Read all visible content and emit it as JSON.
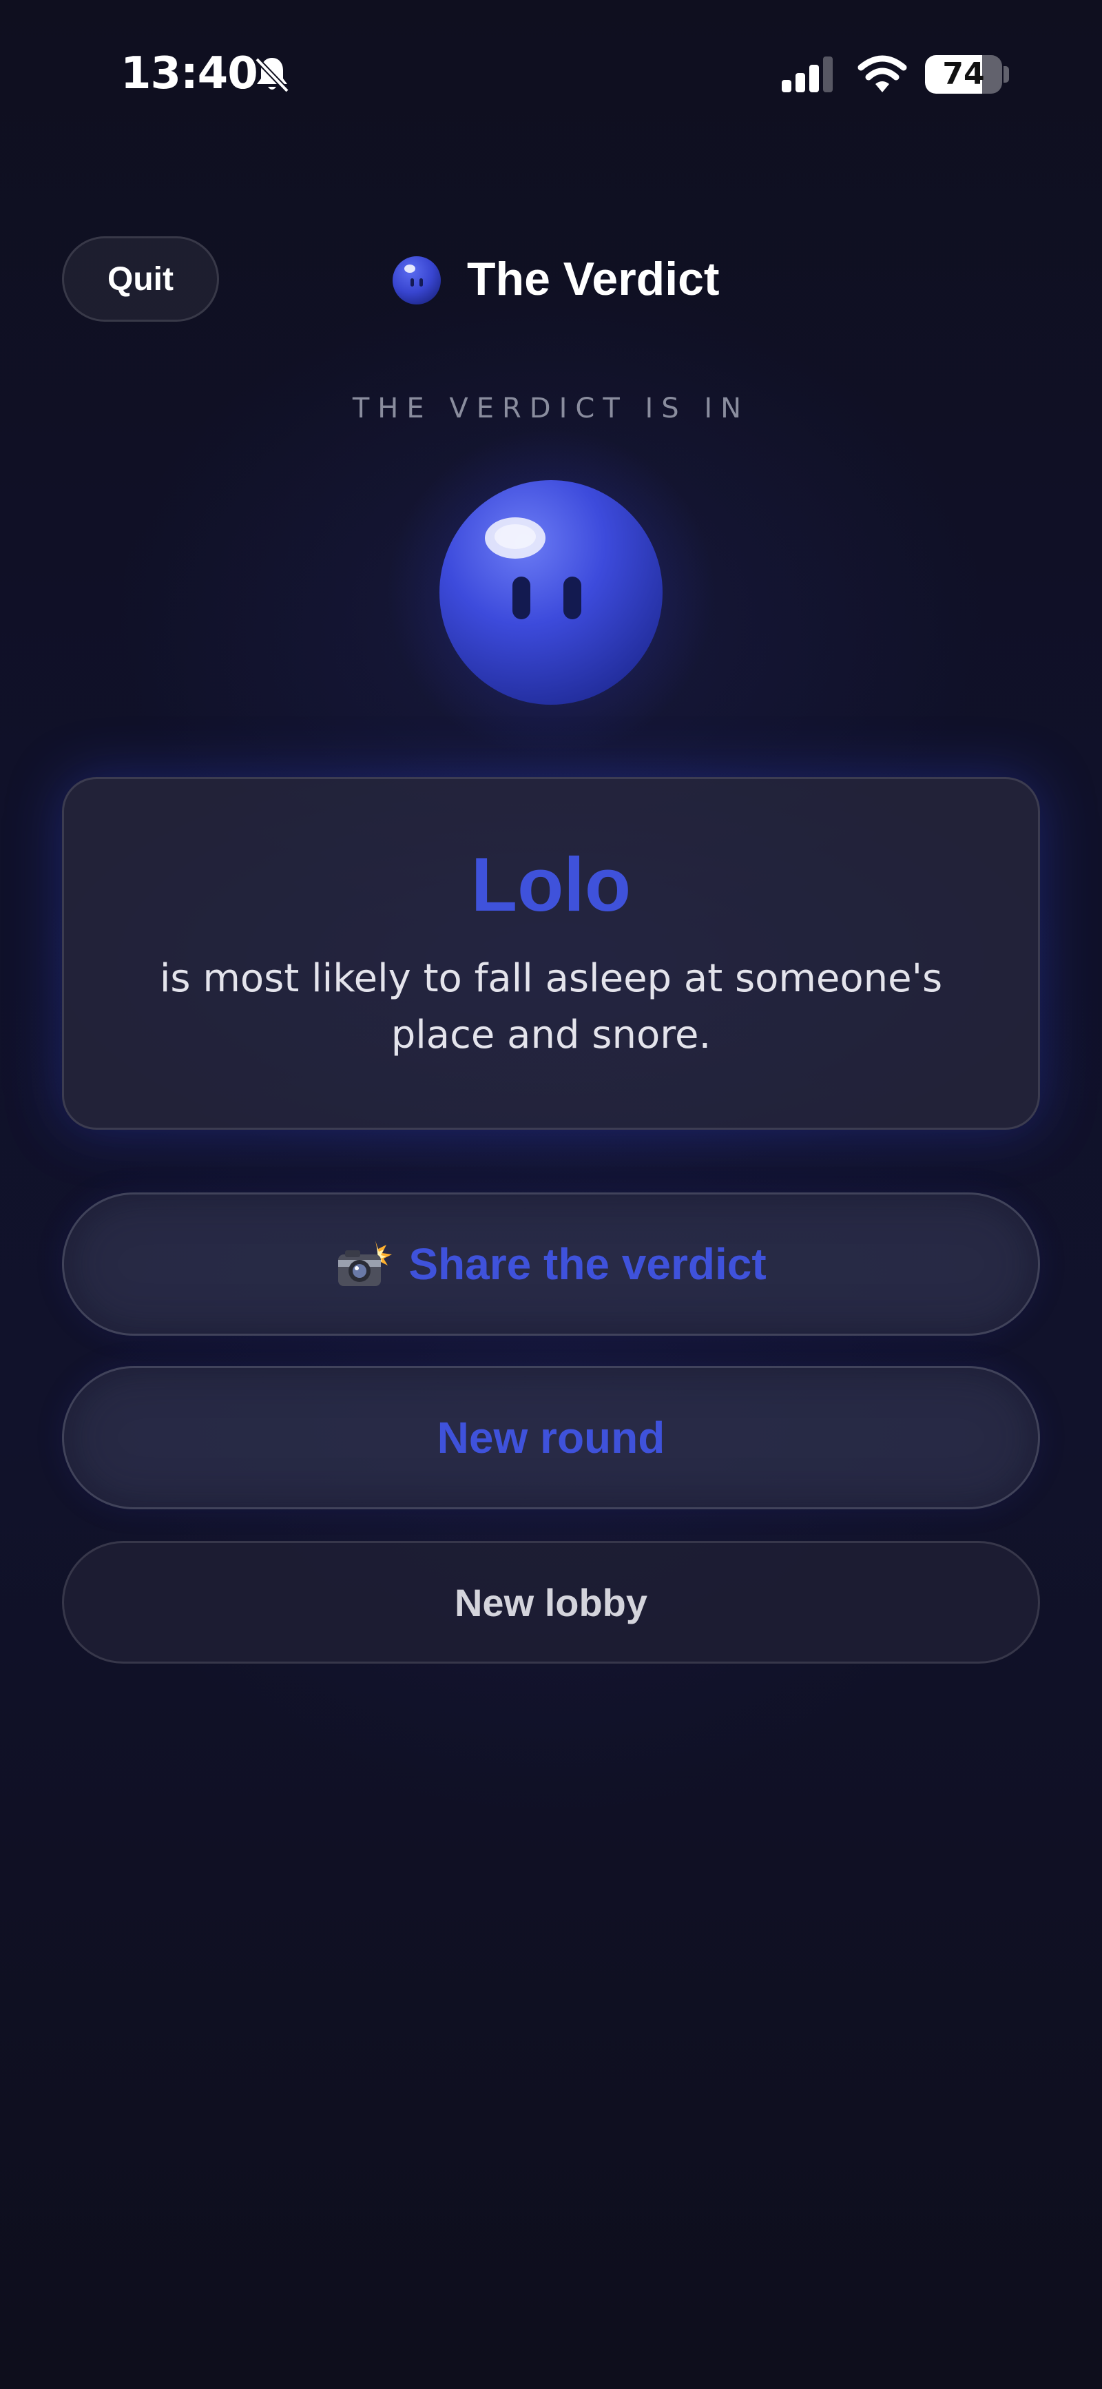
{
  "status_bar": {
    "time": "13:40",
    "battery_level": "74",
    "battery_fraction": 0.74,
    "icons": [
      "bell-muted-icon",
      "cellular-signal-icon",
      "wifi-icon",
      "battery-icon"
    ]
  },
  "header": {
    "quit_label": "Quit",
    "title": "The Verdict",
    "logo_icon": "blob-mascot-icon"
  },
  "result": {
    "eyebrow": "THE VERDICT IS IN",
    "player_name": "Lolo",
    "statement": "is most likely to fall asleep at someone's place and snore."
  },
  "actions": {
    "share_label": "Share the verdict",
    "share_icon": "camera-flash-icon",
    "new_round_label": "New round",
    "new_lobby_label": "New lobby"
  },
  "colors": {
    "accent": "#3f52db",
    "background": "#10112a",
    "card": "#28283e",
    "muted_text": "#8a8d9e"
  }
}
